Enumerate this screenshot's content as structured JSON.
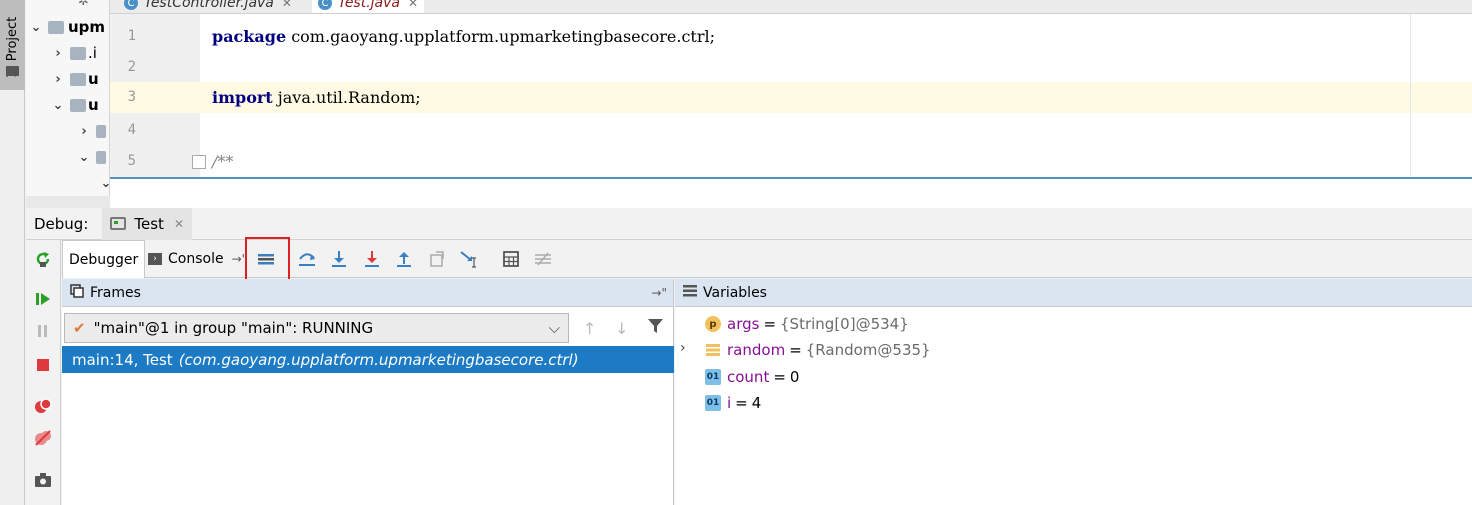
{
  "sidebar": {
    "project_tab": "1: Project"
  },
  "tree": {
    "items": [
      {
        "label": "upm",
        "chevron": "⌄"
      },
      {
        "label": ".i",
        "chevron": "›"
      },
      {
        "label": "u",
        "chevron": "›"
      },
      {
        "label": "u",
        "chevron": "⌄"
      },
      {
        "label": "",
        "chevron": "›"
      },
      {
        "label": "",
        "chevron": "⌄"
      }
    ]
  },
  "editor": {
    "tabs": [
      {
        "label": "TestController.java",
        "icon": "C"
      },
      {
        "label": "Test.java",
        "icon": "C"
      }
    ],
    "lines": [
      {
        "no": "1",
        "kw": "package",
        "rest": " com.gaoyang.upplatform.upmarketingbasecore.ctrl;"
      },
      {
        "no": "2",
        "kw": "",
        "rest": ""
      },
      {
        "no": "3",
        "kw": "import",
        "rest": " java.util.Random;"
      },
      {
        "no": "4",
        "kw": "",
        "rest": ""
      },
      {
        "no": "5",
        "kw": "",
        "rest": "/**"
      }
    ]
  },
  "debug": {
    "label": "Debug:",
    "session_tab": "Test",
    "subtabs": {
      "debugger": "Debugger",
      "console": "Console"
    }
  },
  "frames": {
    "title": "Frames",
    "thread": "\"main\"@1 in group \"main\": RUNNING",
    "selected_frame": {
      "location": "main:14, Test",
      "package": "(com.gaoyang.upplatform.upmarketingbasecore.ctrl)"
    }
  },
  "variables": {
    "title": "Variables",
    "items": [
      {
        "badge": "p",
        "name": "args",
        "eq": "=",
        "value": "{String[0]@534}"
      },
      {
        "badge": "f",
        "name": "random",
        "eq": "=",
        "value": "{Random@535}"
      },
      {
        "badge": "01",
        "name": "count",
        "eq": "=",
        "value": "0"
      },
      {
        "badge": "01",
        "name": "i",
        "eq": "=",
        "value": "4"
      }
    ]
  },
  "colors": {
    "selection": "#1d7bc6",
    "highlight_box": "#e02020",
    "panel_header": "#dbe5f1"
  }
}
